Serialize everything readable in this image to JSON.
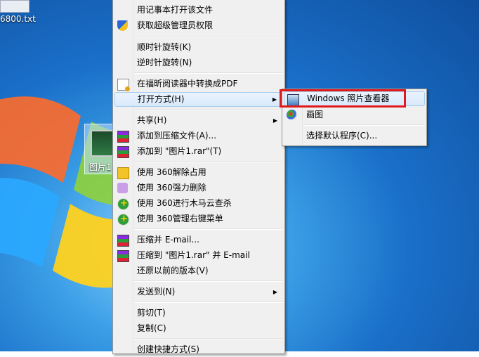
{
  "desktop": {
    "top_file_label": "6800.txt",
    "icon_label": "图片1"
  },
  "context_menu": {
    "items": [
      {
        "label": "用记事本打开该文件"
      },
      {
        "label": "获取超级管理员权限"
      },
      {
        "label": "顺时针旋转(K)"
      },
      {
        "label": "逆时针旋转(N)"
      },
      {
        "label": "在福昕阅读器中转换成PDF"
      },
      {
        "label": "打开方式(H)"
      },
      {
        "label": "共享(H)"
      },
      {
        "label": "添加到压缩文件(A)..."
      },
      {
        "label": "添加到 \"图片1.rar\"(T)"
      },
      {
        "label": "使用 360解除占用"
      },
      {
        "label": "使用 360强力删除"
      },
      {
        "label": "使用 360进行木马云查杀"
      },
      {
        "label": "使用 360管理右键菜单"
      },
      {
        "label": "压缩并 E-mail..."
      },
      {
        "label": "压缩到 \"图片1.rar\" 并 E-mail"
      },
      {
        "label": "还原以前的版本(V)"
      },
      {
        "label": "发送到(N)"
      },
      {
        "label": "剪切(T)"
      },
      {
        "label": "复制(C)"
      },
      {
        "label": "创建快捷方式(S)"
      }
    ]
  },
  "open_with_submenu": {
    "items": [
      {
        "label": "Windows 照片查看器"
      },
      {
        "label": "画图"
      },
      {
        "label": "选择默认程序(C)..."
      }
    ]
  },
  "arrow_glyph": "▶"
}
